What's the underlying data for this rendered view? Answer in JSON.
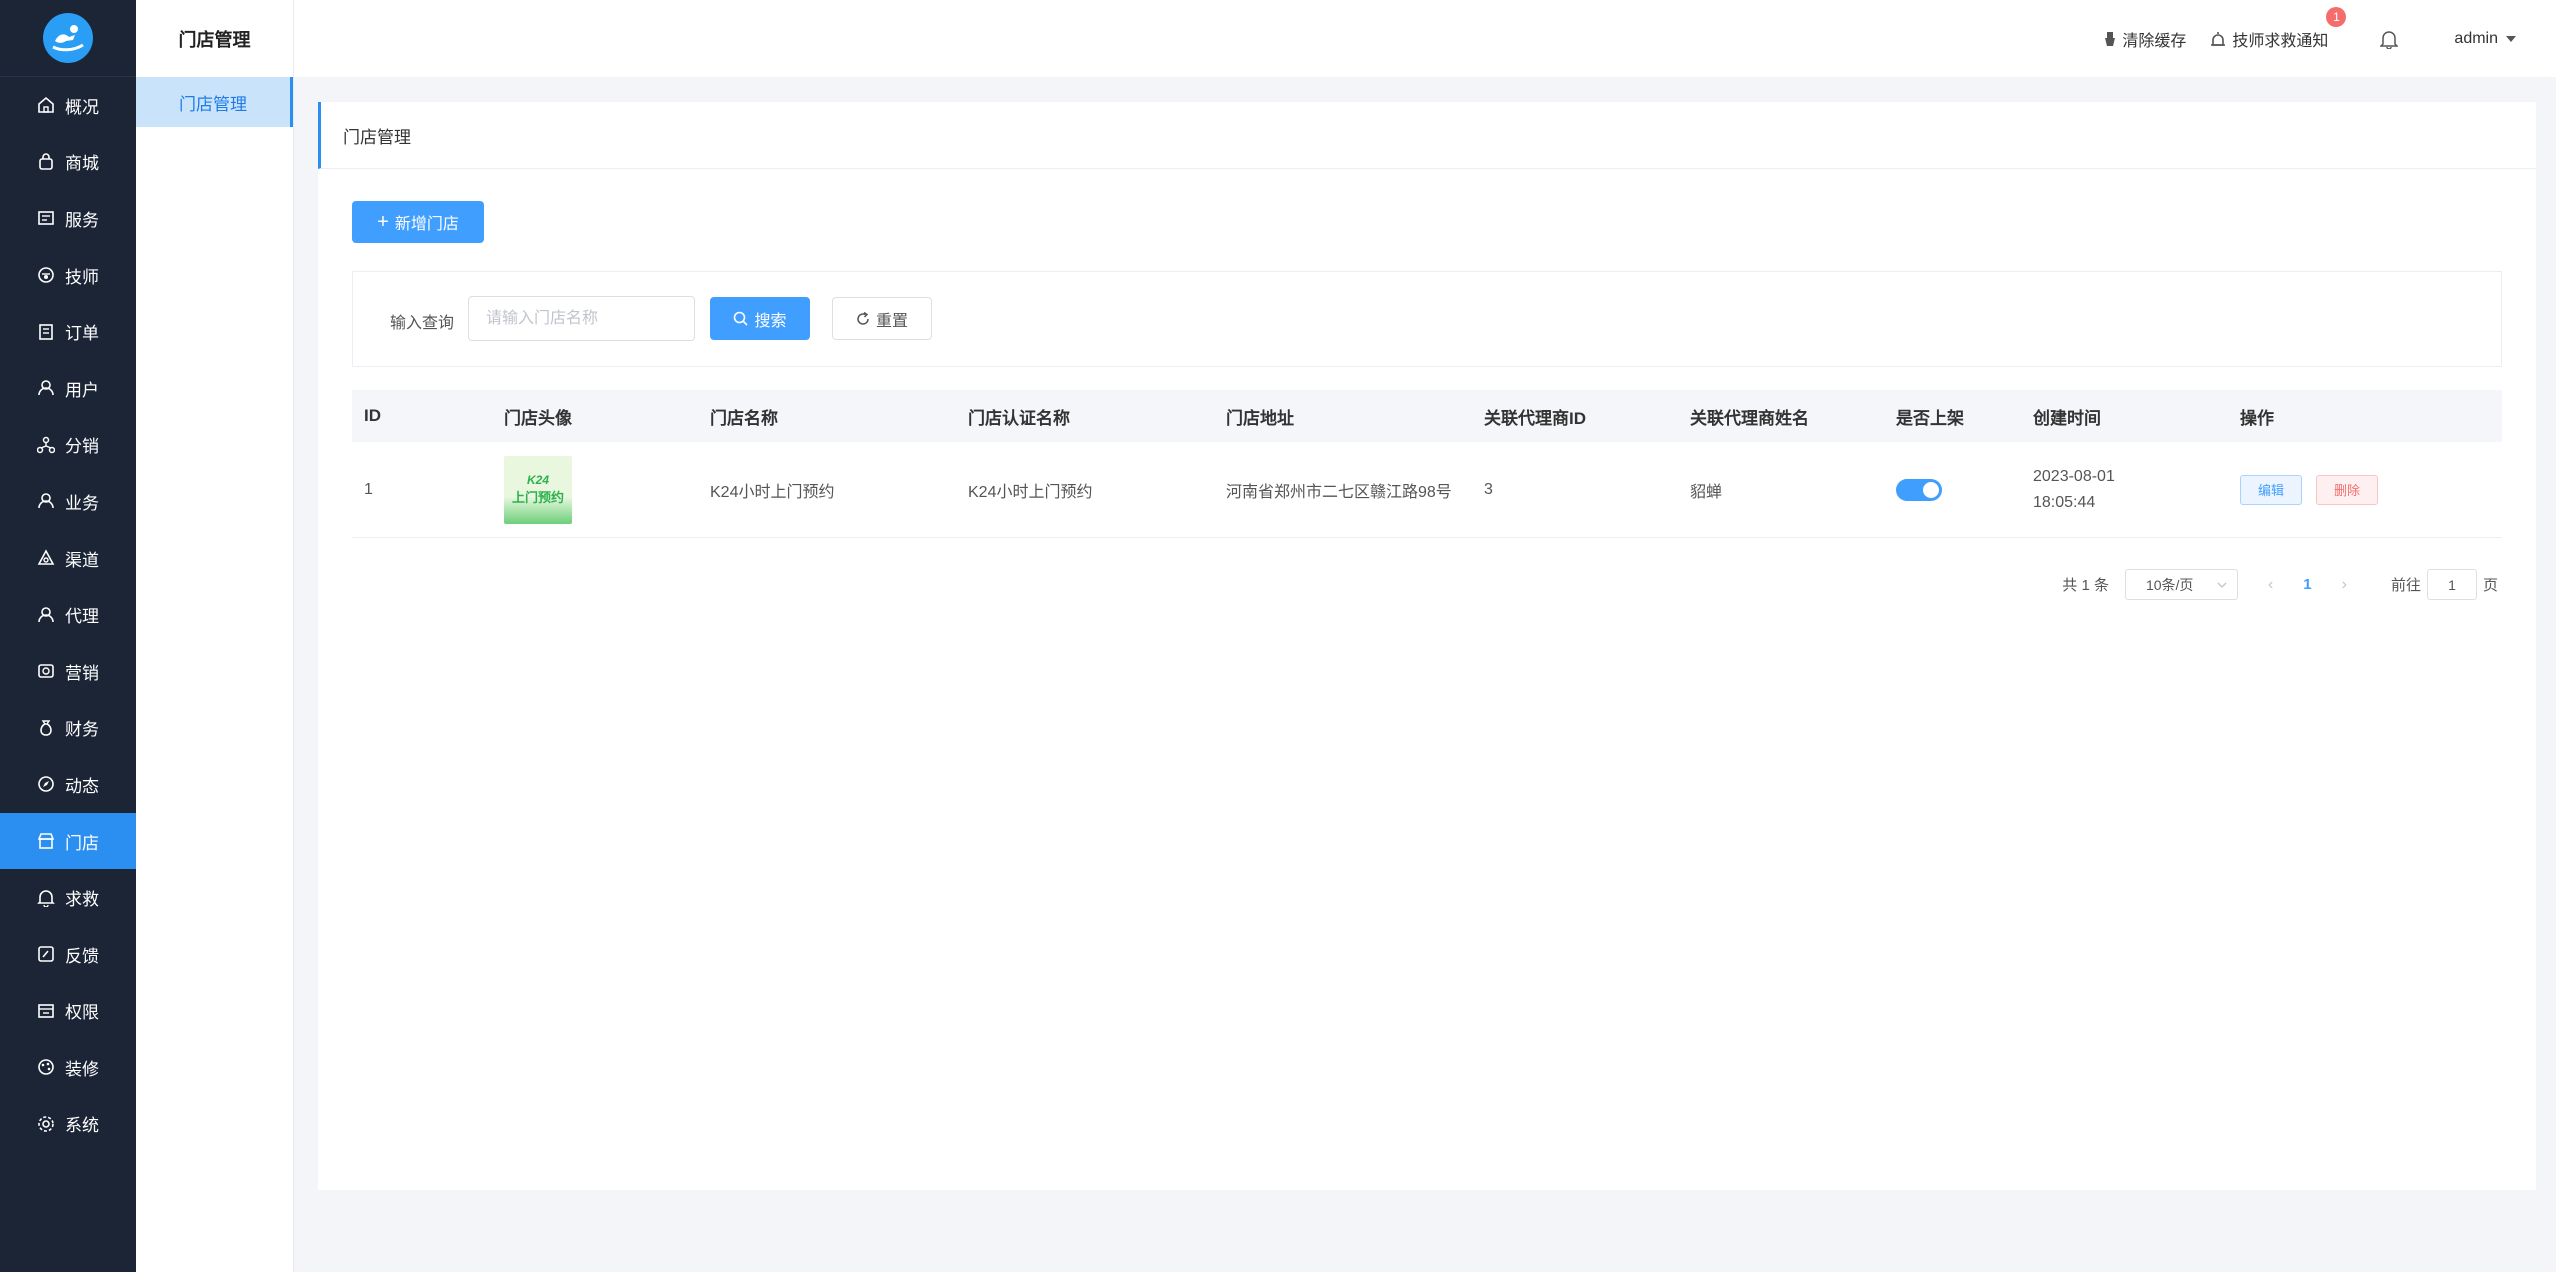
{
  "header": {
    "clear_cache": "清除缓存",
    "rescue_notice": "技师求救通知",
    "rescue_badge": "1",
    "user": "admin"
  },
  "nav": {
    "items": [
      {
        "label": "概况",
        "icon": "home-icon"
      },
      {
        "label": "商城",
        "icon": "bag-icon"
      },
      {
        "label": "服务",
        "icon": "service-icon"
      },
      {
        "label": "技师",
        "icon": "tech-icon"
      },
      {
        "label": "订单",
        "icon": "order-icon"
      },
      {
        "label": "用户",
        "icon": "user-icon"
      },
      {
        "label": "分销",
        "icon": "distribution-icon"
      },
      {
        "label": "业务",
        "icon": "business-icon"
      },
      {
        "label": "渠道",
        "icon": "channel-icon"
      },
      {
        "label": "代理",
        "icon": "agent-icon"
      },
      {
        "label": "营销",
        "icon": "marketing-icon"
      },
      {
        "label": "财务",
        "icon": "finance-icon"
      },
      {
        "label": "动态",
        "icon": "compass-icon"
      },
      {
        "label": "门店",
        "icon": "store-icon",
        "active": true
      },
      {
        "label": "求救",
        "icon": "bell-icon"
      },
      {
        "label": "反馈",
        "icon": "feedback-icon"
      },
      {
        "label": "权限",
        "icon": "permission-icon"
      },
      {
        "label": "装修",
        "icon": "decorate-icon"
      },
      {
        "label": "系统",
        "icon": "gear-icon"
      }
    ]
  },
  "subnav": {
    "title": "门店管理",
    "item": "门店管理"
  },
  "page": {
    "title": "门店管理",
    "add_button": "新增门店"
  },
  "search": {
    "label": "输入查询",
    "placeholder": "请输入门店名称",
    "search_button": "搜索",
    "reset_button": "重置"
  },
  "table": {
    "columns": [
      "ID",
      "门店头像",
      "门店名称",
      "门店认证名称",
      "门店地址",
      "关联代理商ID",
      "关联代理商姓名",
      "是否上架",
      "创建时间",
      "操作"
    ],
    "rows": [
      {
        "id": "1",
        "avatar_line1": "K24",
        "avatar_line2": "上门预约",
        "name": "K24小时上门预约",
        "cert_name": "K24小时上门预约",
        "address": "河南省郑州市二七区赣江路98号",
        "agent_id": "3",
        "agent_name": "貂蝉",
        "on_shelf": true,
        "created_date": "2023-08-01",
        "created_time": "18:05:44",
        "edit": "编辑",
        "delete": "删除"
      }
    ]
  },
  "pagination": {
    "total": "共 1 条",
    "page_size": "10条/页",
    "current": "1",
    "goto_prefix": "前往",
    "goto_value": "1",
    "goto_suffix": "页"
  },
  "colors": {
    "accent": "#409eff",
    "nav_bg": "#1c2536",
    "nav_active": "#2a8ff0",
    "danger": "#f56c6c"
  }
}
